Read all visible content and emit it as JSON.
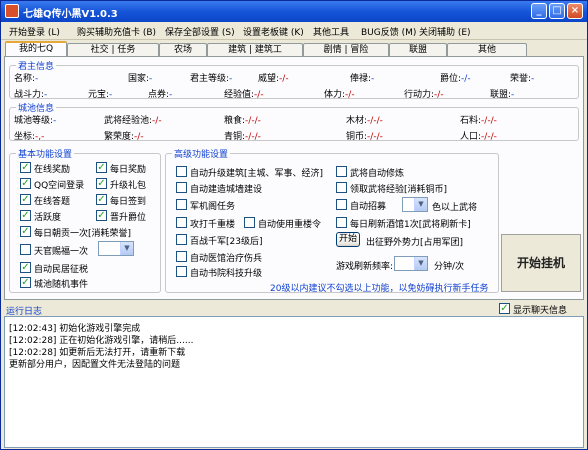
{
  "window": {
    "title": "七雄Q传小黑V1.0.3",
    "min": "_",
    "max": "□",
    "close": "×"
  },
  "menu": [
    "开始登录 (L)",
    "购买辅助充值卡 (B)",
    "保存全部设置 (S)",
    "设置老板键 (K)",
    "其他工具",
    "BUG反馈 (M)",
    "关闭辅助 (E)"
  ],
  "tabs": [
    "我的七Q",
    "社交 | 任务",
    "农场",
    "建筑 | 建筑工",
    "剧情 | 冒险",
    "联盟",
    "其他"
  ],
  "lord": {
    "title": "君主信息",
    "row1": [
      {
        "k": "名称:",
        "v": "-"
      },
      {
        "k": "国家:",
        "v": "-"
      },
      {
        "k": "君主等级:",
        "v": "-"
      },
      {
        "k": "威望:",
        "v": "-/-"
      },
      {
        "k": "俸禄:",
        "v": "-"
      },
      {
        "k": "爵位:",
        "v": "-/-"
      },
      {
        "k": "荣誉:",
        "v": "-"
      }
    ],
    "row2": [
      {
        "k": "战斗力:",
        "v": "-"
      },
      {
        "k": "元宝:",
        "v": "-"
      },
      {
        "k": "点券:",
        "v": "-"
      },
      {
        "k": "经验值:",
        "v": "-/-"
      },
      {
        "k": "体力:",
        "v": "-/-"
      },
      {
        "k": "行动力:",
        "v": "-/-"
      },
      {
        "k": "联盟:",
        "v": "-"
      }
    ]
  },
  "city": {
    "title": "城池信息",
    "row1": [
      {
        "k": "城池等级:",
        "v": "-"
      },
      {
        "k": "武将经验池:",
        "v": "-/-"
      },
      {
        "k": "粮食:",
        "v": "-/-/-"
      },
      {
        "k": "木材:",
        "v": "-/-/-"
      },
      {
        "k": "石料:",
        "v": "-/-/-"
      }
    ],
    "row2": [
      {
        "k": "坐标:",
        "v": "-,-"
      },
      {
        "k": "繁荣度:",
        "v": "-/-"
      },
      {
        "k": "青铜:",
        "v": "-/-/-"
      },
      {
        "k": "铜币:",
        "v": "-/-/-"
      },
      {
        "k": "人口:",
        "v": "-/-/-"
      }
    ]
  },
  "basic": {
    "title": "基本功能设置",
    "items": [
      {
        "label": "在线奖励",
        "checked": true
      },
      {
        "label": "每日奖励",
        "checked": true
      },
      {
        "label": "QQ空间登录",
        "checked": true
      },
      {
        "label": "升级礼包",
        "checked": true
      },
      {
        "label": "在线答题",
        "checked": true
      },
      {
        "label": "每日签到",
        "checked": true
      },
      {
        "label": "活跃度",
        "checked": true
      },
      {
        "label": "晋升爵位",
        "checked": true
      },
      {
        "label": "每日朝贡一次[消耗荣誉]",
        "checked": true
      },
      {
        "label": "天官赐福一次",
        "checked": false
      },
      {
        "label": "自动民居征税",
        "checked": true
      },
      {
        "label": "城池随机事件",
        "checked": true
      }
    ]
  },
  "advanced": {
    "title": "高级功能设置",
    "left": [
      {
        "label": "自动升级建筑[主城、军事、经济]",
        "checked": false
      },
      {
        "label": "自动建造城墙建设",
        "checked": false
      },
      {
        "label": "军机阁任务",
        "checked": false
      },
      {
        "label": "攻打千重楼",
        "checked": false
      },
      {
        "label": "自动使用重楼令",
        "checked": false
      },
      {
        "label": "百战千军[23级后]",
        "checked": false
      },
      {
        "label": "自动医馆治疗伤兵",
        "checked": false
      },
      {
        "label": "自动书院科技升级",
        "checked": false
      }
    ],
    "right": [
      {
        "label": "武将自动修炼",
        "checked": false
      },
      {
        "label": "领取武将经验[消耗铜币]",
        "checked": false
      },
      {
        "label": "自动招募",
        "checked": false
      },
      {
        "label": "色以上武将",
        "checked": false
      },
      {
        "label": "每日刷新酒馆1次[武将刷新卡]",
        "checked": false
      }
    ],
    "start_btn": "开始",
    "expedition": "出征野外势力[占用军团]",
    "refresh_label": "游戏刷新频率:",
    "refresh_unit": "分钟/次",
    "hint": "20级以内建议不勾选以上功能，以免妨碍执行新手任务"
  },
  "start_button": "开始挂机",
  "log": {
    "title": "运行日志",
    "show_chat": "显示聊天信息",
    "show_chat_checked": true,
    "lines": [
      "[12:02:43] 初始化游戏引擎完成",
      "[12:02:28] 正在初始化游戏引擎，请稍后......",
      "[12:02:28] 如更新后无法打开，请重新下载",
      "           更新部分用户，因配置文件无法登陆的问题"
    ]
  }
}
